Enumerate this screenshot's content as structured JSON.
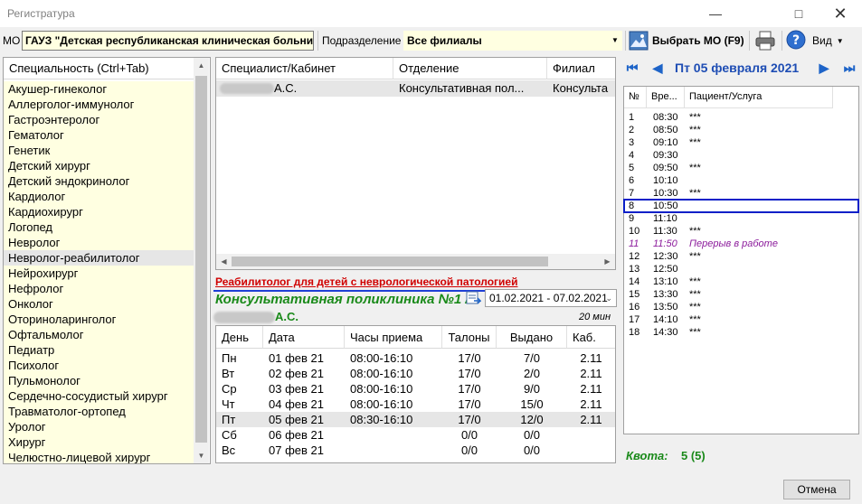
{
  "window": {
    "title": "Регистратура"
  },
  "toolbar": {
    "mo_label": "МО",
    "mo_value": "ГАУЗ \"Детская республиканская клиническая больни",
    "podrazdelenie_label": "Подразделение",
    "podrazdelenie_value": "Все филиалы",
    "choose_mo_label": "Выбрать МО (F9)",
    "view_label": "Вид"
  },
  "specialties": {
    "header": "Специальность (Ctrl+Tab)",
    "items": [
      "Акушер-гинеколог",
      "Аллерголог-иммунолог",
      "Гастроэнтеролог",
      "Гематолог",
      "Генетик",
      "Детский хирург",
      "Детский эндокринолог",
      "Кардиолог",
      "Кардиохирург",
      "Логопед",
      "Невролог",
      "Невролог-реабилитолог",
      "Нейрохирург",
      "Нефролог",
      "Онколог",
      "Оториноларинголог",
      "Офтальмолог",
      "Педиатр",
      "Психолог",
      "Пульмонолог",
      "Сердечно-сосудистый хирург",
      "Травматолог-ортопед",
      "Уролог",
      "Хирург",
      "Челюстно-лицевой хирург"
    ],
    "selected_index": 11
  },
  "specialists": {
    "columns": [
      "Специалист/Кабинет",
      "Отделение",
      "Филиал"
    ],
    "rows": [
      {
        "name": "А.С.",
        "dept": "Консультативная пол...",
        "branch": "Консульта"
      }
    ]
  },
  "detail": {
    "link": "Реабилитолог для детей с неврологической патологией",
    "clinic": "Консультативная поликлиника №1 /.",
    "date_range": "01.02.2021 - 07.02.2021",
    "doctor": "А.С.",
    "duration": "20 мин"
  },
  "week": {
    "columns": [
      "День",
      "Дата",
      "Часы приема",
      "Талоны",
      "Выдано",
      "Каб."
    ],
    "rows": [
      {
        "day": "Пн",
        "date": "01 фев 21",
        "hours": "08:00-16:10",
        "talons": "17/0",
        "issued": "7/0",
        "cab": "2.11"
      },
      {
        "day": "Вт",
        "date": "02 фев 21",
        "hours": "08:00-16:10",
        "talons": "17/0",
        "issued": "2/0",
        "cab": "2.11"
      },
      {
        "day": "Ср",
        "date": "03 фев 21",
        "hours": "08:00-16:10",
        "talons": "17/0",
        "issued": "9/0",
        "cab": "2.11"
      },
      {
        "day": "Чт",
        "date": "04 фев 21",
        "hours": "08:00-16:10",
        "talons": "17/0",
        "issued": "15/0",
        "cab": "2.11"
      },
      {
        "day": "Пт",
        "date": "05 фев 21",
        "hours": "08:30-16:10",
        "talons": "17/0",
        "issued": "12/0",
        "cab": "2.11"
      },
      {
        "day": "Сб",
        "date": "06 фев 21",
        "hours": "",
        "talons": "0/0",
        "issued": "0/0",
        "cab": ""
      },
      {
        "day": "Вс",
        "date": "07 фев 21",
        "hours": "",
        "talons": "0/0",
        "issued": "0/0",
        "cab": ""
      }
    ],
    "selected_index": 4
  },
  "schedule": {
    "date": "Пт 05 февраля 2021",
    "columns": [
      "№",
      "Вре...",
      "Пациент/Услуга"
    ],
    "rows": [
      {
        "n": "1",
        "time": "08:30",
        "patient": "***"
      },
      {
        "n": "2",
        "time": "08:50",
        "patient": "***"
      },
      {
        "n": "3",
        "time": "09:10",
        "patient": "***"
      },
      {
        "n": "4",
        "time": "09:30",
        "patient": ""
      },
      {
        "n": "5",
        "time": "09:50",
        "patient": "***"
      },
      {
        "n": "6",
        "time": "10:10",
        "patient": ""
      },
      {
        "n": "7",
        "time": "10:30",
        "patient": "***"
      },
      {
        "n": "8",
        "time": "10:50",
        "patient": ""
      },
      {
        "n": "9",
        "time": "11:10",
        "patient": ""
      },
      {
        "n": "10",
        "time": "11:30",
        "patient": "***"
      },
      {
        "n": "11",
        "time": "11:50",
        "patient": "Перерыв в работе"
      },
      {
        "n": "12",
        "time": "12:30",
        "patient": "***"
      },
      {
        "n": "13",
        "time": "12:50",
        "patient": ""
      },
      {
        "n": "14",
        "time": "13:10",
        "patient": "***"
      },
      {
        "n": "15",
        "time": "13:30",
        "patient": "***"
      },
      {
        "n": "16",
        "time": "13:50",
        "patient": "***"
      },
      {
        "n": "17",
        "time": "14:10",
        "patient": "***"
      },
      {
        "n": "18",
        "time": "14:30",
        "patient": "***"
      }
    ],
    "break_index": 10,
    "highlight_index": 7
  },
  "kvota": {
    "label": "Квота:",
    "value": "5 (5)"
  },
  "footer": {
    "cancel_label": "Отмена"
  },
  "colors": {
    "accent": "#1e64c8",
    "green": "#1a8a1a",
    "red_link": "#d00000",
    "input_bg": "#ffffe1"
  }
}
